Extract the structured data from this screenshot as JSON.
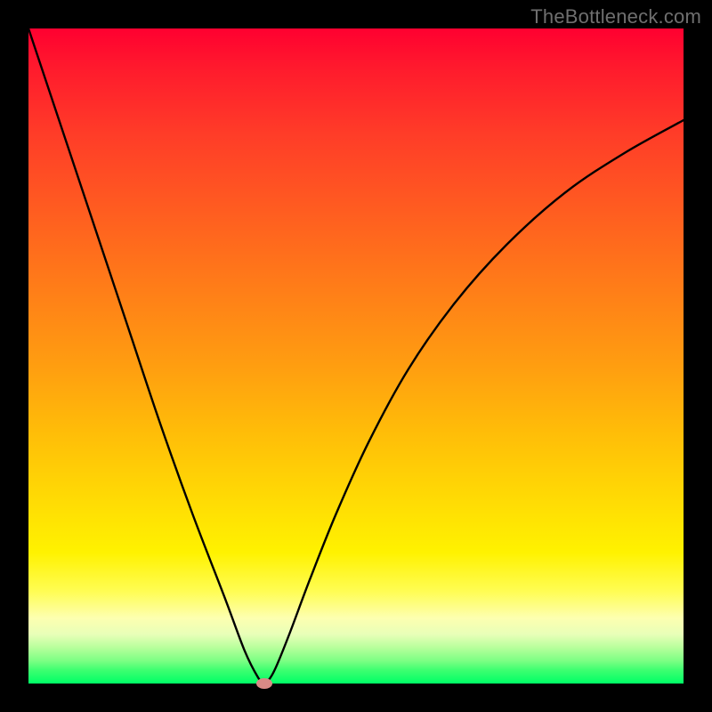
{
  "watermark": "TheBottleneck.com",
  "colors": {
    "black": "#000000",
    "curve": "#000000",
    "marker": "#d98a86"
  },
  "chart_data": {
    "type": "line",
    "title": "",
    "xlabel": "",
    "ylabel": "",
    "xlim": [
      0,
      100
    ],
    "ylim": [
      0,
      100
    ],
    "grid": false,
    "legend": false,
    "background": "gradient red→orange→yellow→green (top→bottom)",
    "series": [
      {
        "name": "curve",
        "x": [
          0,
          5,
          10,
          15,
          20,
          25,
          30,
          33,
          35,
          36,
          37,
          38,
          40,
          43,
          47,
          52,
          58,
          65,
          73,
          82,
          91,
          100
        ],
        "y": [
          100,
          85,
          70,
          55,
          40,
          26,
          13,
          5,
          1,
          0,
          1,
          3,
          8,
          16,
          26,
          37,
          48,
          58,
          67,
          75,
          81,
          86
        ]
      }
    ],
    "marker": {
      "x": 36,
      "y": 0
    }
  }
}
